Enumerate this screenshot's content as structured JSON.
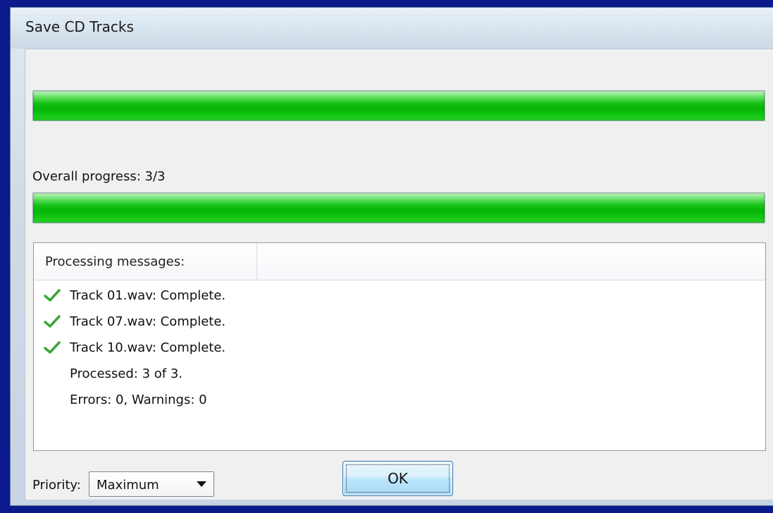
{
  "window": {
    "title": "Save CD Tracks"
  },
  "progress": {
    "track_fraction": 1.0,
    "overall_label": "Overall progress:  3/3",
    "overall_fraction": 1.0
  },
  "messages": {
    "header": "Processing messages:",
    "items": [
      {
        "text": "Track 01.wav: Complete.",
        "icon": "check-icon"
      },
      {
        "text": "Track 07.wav: Complete.",
        "icon": "check-icon"
      },
      {
        "text": "Track 10.wav: Complete.",
        "icon": "check-icon"
      },
      {
        "text": "Processed: 3 of 3.",
        "icon": ""
      },
      {
        "text": "Errors: 0,  Warnings: 0",
        "icon": ""
      }
    ]
  },
  "footer": {
    "priority_label": "Priority:",
    "priority_value": "Maximum",
    "ok_label": "OK"
  },
  "colors": {
    "progress_fill": "#06b406",
    "check": "#3aa63a",
    "desktop": "#0a1a8c"
  }
}
